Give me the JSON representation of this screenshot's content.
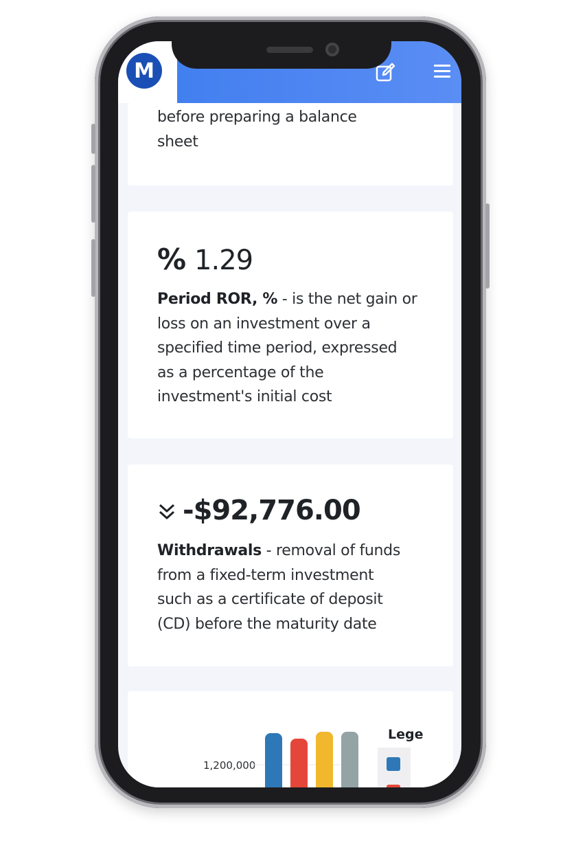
{
  "header": {
    "logo_letter": "M",
    "edit_icon": "edit-icon",
    "menu_icon": "hamburger-menu-icon",
    "background": "#4f86f2"
  },
  "cards": {
    "partial_text_line1": "before preparing a balance",
    "partial_text_line2": "sheet",
    "ror": {
      "symbol": "%",
      "value": "1.29",
      "term": "Period ROR, %",
      "description_lines": [
        " - is the net gain or",
        "loss on an investment over a",
        "specified time period, expressed",
        "as a percentage of the",
        "investment's initial cost"
      ]
    },
    "withdrawals": {
      "icon": "double-chevron-down-icon",
      "value": "-$92,776.00",
      "term": "Withdrawals",
      "description_lines": [
        " - removal of funds",
        "from a fixed-term investment",
        "such as a certificate of deposit",
        "(CD) before the maturity date"
      ]
    }
  },
  "chart_data": {
    "type": "bar",
    "title": "",
    "y_tick_label": "1,200,000",
    "legend_title": "Lege",
    "series_colors": [
      "#2f78b8",
      "#e4473a",
      "#f1b82e",
      "#94a3a6"
    ],
    "legend_colors": [
      "#2f78b8",
      "#e4473a"
    ]
  }
}
